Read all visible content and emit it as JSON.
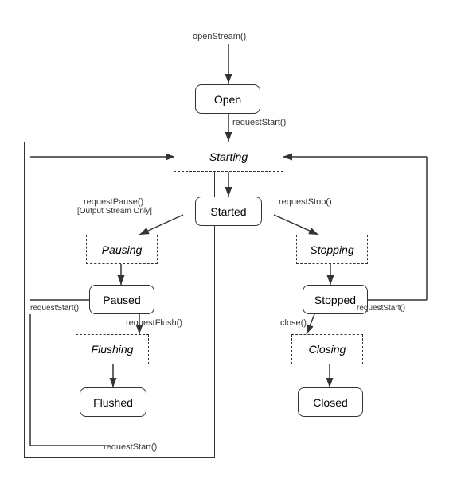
{
  "states": {
    "open": {
      "label": "Open"
    },
    "starting": {
      "label": "Starting"
    },
    "started": {
      "label": "Started"
    },
    "pausing": {
      "label": "Pausing"
    },
    "paused": {
      "label": "Paused"
    },
    "flushing": {
      "label": "Flushing"
    },
    "flushed": {
      "label": "Flushed"
    },
    "stopping": {
      "label": "Stopping"
    },
    "stopped": {
      "label": "Stopped"
    },
    "closing": {
      "label": "Closing"
    },
    "closed": {
      "label": "Closed"
    }
  },
  "transitions": {
    "openStream": "openStream()",
    "requestStart": "requestStart()",
    "requestPause": "requestPause()",
    "outputStreamOnly": "[Output Stream Only]",
    "requestFlush": "requestFlush()",
    "requestStop": "requestStop()",
    "close": "close()",
    "requestStart2": "requestStart()",
    "requestStart3": "requestStart()"
  }
}
